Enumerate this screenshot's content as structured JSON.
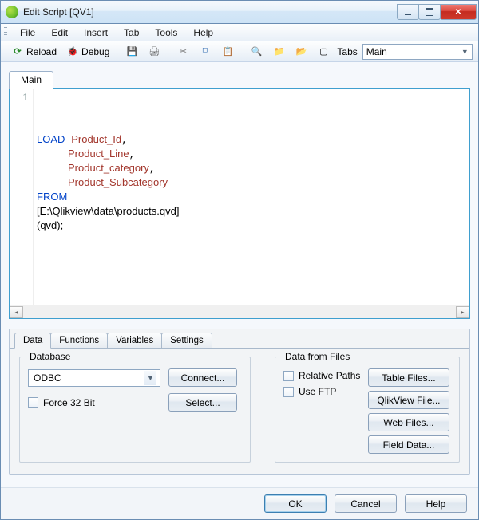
{
  "window": {
    "title": "Edit Script [QV1]"
  },
  "menu": {
    "file": "File",
    "edit": "Edit",
    "insert": "Insert",
    "tab": "Tab",
    "tools": "Tools",
    "help": "Help"
  },
  "toolbar": {
    "reload": "Reload",
    "debug": "Debug",
    "tabs_label": "Tabs",
    "tabs_value": "Main"
  },
  "editor": {
    "tab": "Main",
    "gutter_first": "1",
    "code": {
      "kw_load": "LOAD",
      "f1": "Product_Id",
      "f2": "Product_Line",
      "f3": "Product_category",
      "f4": "Product_Subcategory",
      "kw_from": "FROM",
      "path": "[E:\\Qlikview\\data\\products.qvd]",
      "fmt": "(qvd);"
    }
  },
  "panel": {
    "tabs": {
      "data": "Data",
      "functions": "Functions",
      "variables": "Variables",
      "settings": "Settings"
    },
    "database": {
      "legend": "Database",
      "driver": "ODBC",
      "force32": "Force 32 Bit",
      "connect": "Connect...",
      "select": "Select..."
    },
    "datafiles": {
      "legend": "Data from Files",
      "relative": "Relative Paths",
      "useftp": "Use FTP",
      "tablefiles": "Table Files...",
      "qvfile": "QlikView File...",
      "webfiles": "Web Files...",
      "fielddata": "Field Data..."
    }
  },
  "dialog": {
    "ok": "OK",
    "cancel": "Cancel",
    "help": "Help"
  }
}
